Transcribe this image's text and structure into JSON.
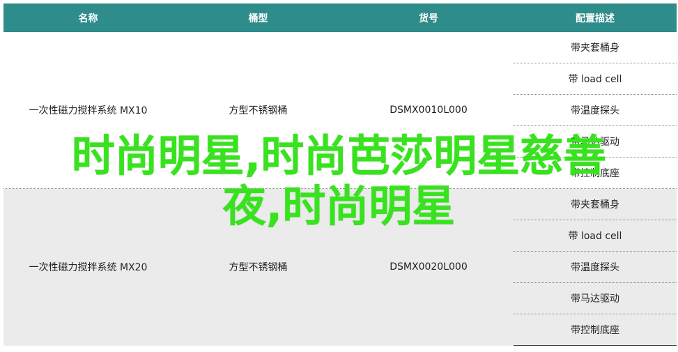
{
  "table": {
    "headers": [
      "名称",
      "桶型",
      "货号",
      "配置描述"
    ],
    "groups": [
      {
        "name": "一次性磁力搅拌系统 MX10",
        "barrel": "方型不锈钢桶",
        "sku": "DSMX0010L000",
        "configs": [
          "带夹套桶身",
          "带 load cell",
          "带温度探头",
          "带马达驱动",
          "带控制底座"
        ]
      },
      {
        "name": "一次性磁力搅拌系统 MX20",
        "barrel": "方型不锈钢桶",
        "sku": "DSMX0020L000",
        "configs": [
          "带夹套桶身",
          "带 load cell",
          "带温度探头",
          "带马达驱动",
          "带控制底座"
        ]
      }
    ]
  },
  "overlay": {
    "line1": "时尚明星,时尚芭莎明星慈善",
    "line2": "夜,时尚明星"
  },
  "colors": {
    "header_bg": "#2e8c8a",
    "header_text": "#ffffff",
    "group2_bg": "#ebebeb",
    "overlay_text": "#39e21f"
  }
}
